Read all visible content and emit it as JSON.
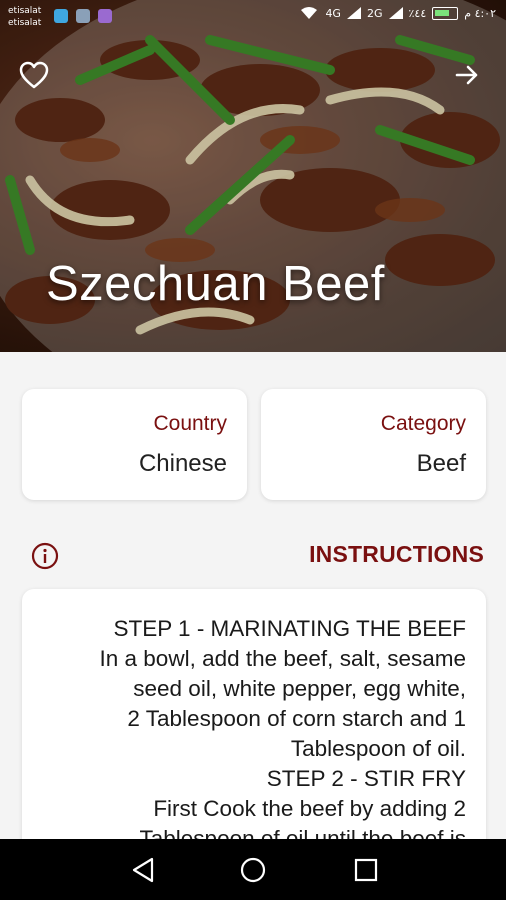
{
  "status_bar": {
    "carrier_1": "etisalat",
    "carrier_2": "etisalat",
    "signal_1": "4G",
    "signal_2": "2G",
    "battery_text": "٪٤٤",
    "time": "٤:٠٢ م"
  },
  "meal": {
    "name": "Szechuan Beef",
    "country_label": "Country",
    "country": "Chinese",
    "category_label": "Category",
    "category": "Beef"
  },
  "instructions": {
    "title": "INSTRUCTIONS",
    "lines": [
      "STEP 1 - MARINATING THE BEEF",
      "In a bowl, add the beef, salt, sesame",
      "seed oil, white pepper, egg white,",
      "2 Tablespoon of corn starch and 1",
      "Tablespoon of oil.",
      "STEP 2 - STIR FRY",
      "First Cook the beef by adding 2",
      "Tablespoon of oil until the beef is"
    ]
  },
  "colors": {
    "accent": "#7a1010",
    "background": "#f4f4f4",
    "card": "#ffffff"
  },
  "icons": {
    "favorite": "heart-outline-icon",
    "forward": "arrow-right-icon",
    "info": "info-circle-icon",
    "nav_back": "triangle-back-icon",
    "nav_home": "circle-home-icon",
    "nav_recent": "square-recent-icon"
  }
}
